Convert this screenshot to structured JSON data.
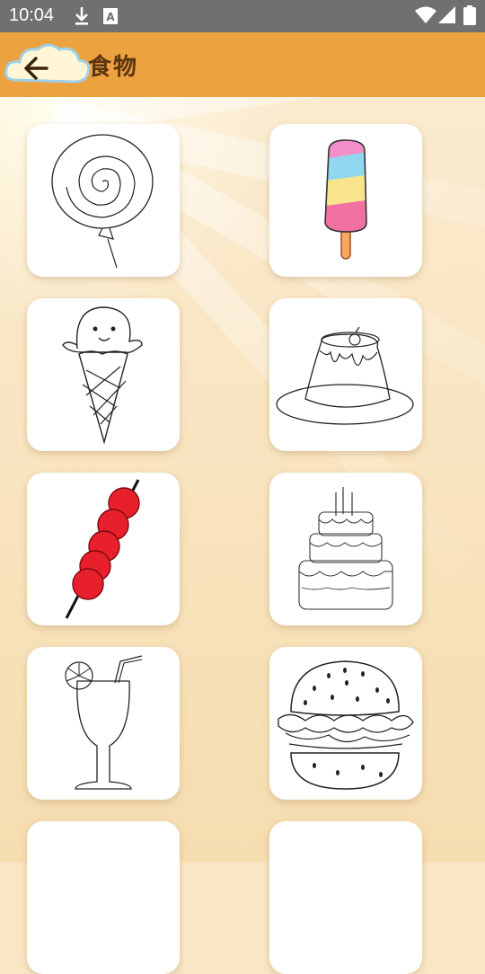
{
  "status_bar": {
    "time": "10:04",
    "icons": [
      "download-icon",
      "a-badge-icon",
      "wifi-icon",
      "signal-icon",
      "battery-icon"
    ]
  },
  "app_bar": {
    "title": "食物",
    "back_icon": "back-arrow-icon",
    "color": "#eba23f"
  },
  "items": [
    {
      "name": "lollipop",
      "type": "line-art"
    },
    {
      "name": "popsicle",
      "type": "colored"
    },
    {
      "name": "ice-cream-cone",
      "type": "line-art"
    },
    {
      "name": "pudding",
      "type": "line-art"
    },
    {
      "name": "tanghulu",
      "type": "colored"
    },
    {
      "name": "birthday-cake",
      "type": "line-art"
    },
    {
      "name": "cocktail-drink",
      "type": "line-art"
    },
    {
      "name": "hamburger",
      "type": "line-art"
    },
    {
      "name": "item-9",
      "type": "blank"
    },
    {
      "name": "item-10",
      "type": "blank"
    }
  ]
}
